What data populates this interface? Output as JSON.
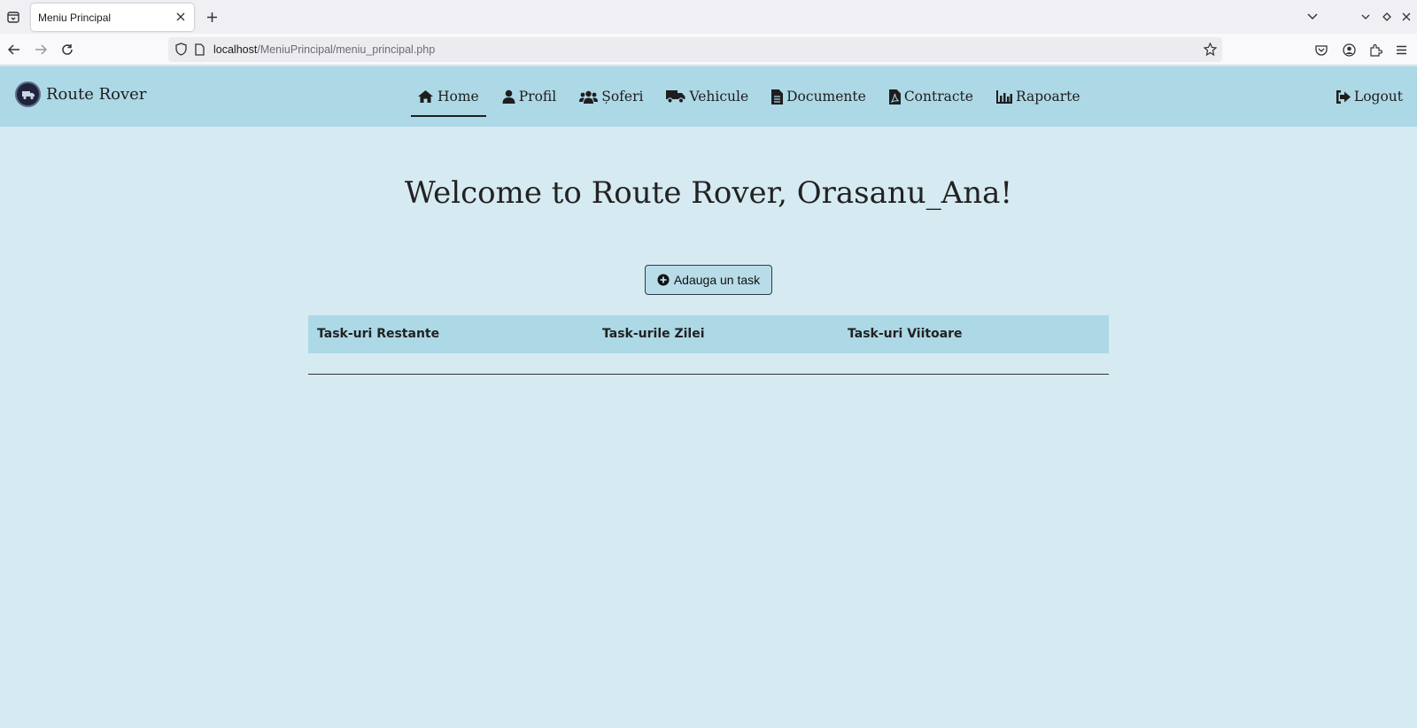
{
  "browser": {
    "tab_title": "Meniu Principal",
    "url_host": "localhost",
    "url_path": "/MeniuPrincipal/meniu_principal.php"
  },
  "header": {
    "brand": "Route Rover",
    "menu": [
      {
        "label": "Home",
        "icon": "home-icon",
        "active": true
      },
      {
        "label": "Profil",
        "icon": "user-icon"
      },
      {
        "label": "Șoferi",
        "icon": "users-icon"
      },
      {
        "label": "Vehicule",
        "icon": "truck-icon"
      },
      {
        "label": "Documente",
        "icon": "document-icon"
      },
      {
        "label": "Contracte",
        "icon": "pdf-file-icon"
      },
      {
        "label": "Rapoarte",
        "icon": "chart-icon"
      }
    ],
    "logout": "Logout"
  },
  "main": {
    "welcome": "Welcome to Route Rover, Orasanu_Ana!",
    "add_task": "Adauga un task",
    "columns": [
      "Task-uri Restante",
      "Task-urile Zilei",
      "Task-uri Viitoare"
    ]
  },
  "colors": {
    "header_bg": "#add8e6",
    "page_bg": "#d6eaf1"
  }
}
